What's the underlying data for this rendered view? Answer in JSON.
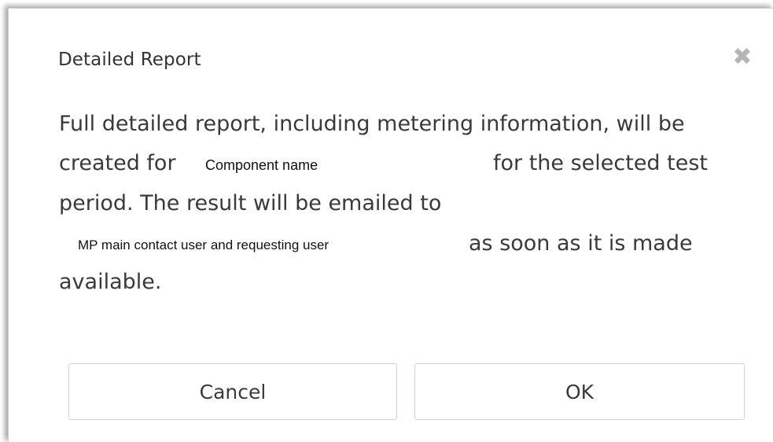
{
  "dialog": {
    "title": "Detailed Report",
    "close_icon": "close-icon",
    "message": {
      "line1": "Full detailed report, including metering information, will be",
      "line2_prefix": "created for",
      "component_name": "Component name",
      "line2_suffix": "for the selected test",
      "line3": "period. The result will be emailed to",
      "recipients": "MP main contact user and requesting user",
      "line4_suffix": "as soon as it is made",
      "line5": "available."
    },
    "buttons": {
      "cancel_label": "Cancel",
      "ok_label": "OK"
    }
  }
}
